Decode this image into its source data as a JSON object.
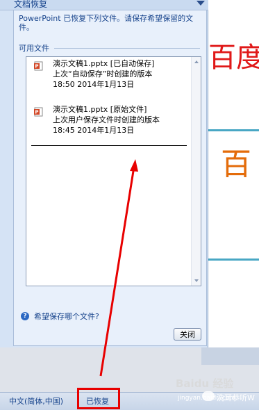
{
  "pane": {
    "title": "文档恢复",
    "description": "PowerPoint 已恢复下列文件。请保存希望保留的文件。",
    "section_label": "可用文件",
    "help_link": "希望保存哪个文件?",
    "close_label": "关闭"
  },
  "files": [
    {
      "name": "演示文稿1.pptx  [已自动保存]",
      "detail": "上次“自动保存”时创建的版本",
      "time": "18:50 2014年1月13日",
      "icon": "pptx-file-icon"
    },
    {
      "name": "演示文稿1.pptx  [原始文件]",
      "detail": "上次用户保存文件时创建的版本",
      "time": "18:45 2014年1月13日",
      "icon": "pptx-file-icon"
    }
  ],
  "slide": {
    "red_text": "百度",
    "orange_text": "百"
  },
  "status_bar": {
    "language": "中文(简体,中国)",
    "recovered": "已恢复"
  },
  "watermark": {
    "text": "Baidu 经验",
    "sub": "jingyan.baidu.com",
    "account": "洗耳恭听W"
  },
  "colors": {
    "annotation": "#e80000",
    "pane_text": "#15428b",
    "slide_accent": "#48a7c4"
  }
}
